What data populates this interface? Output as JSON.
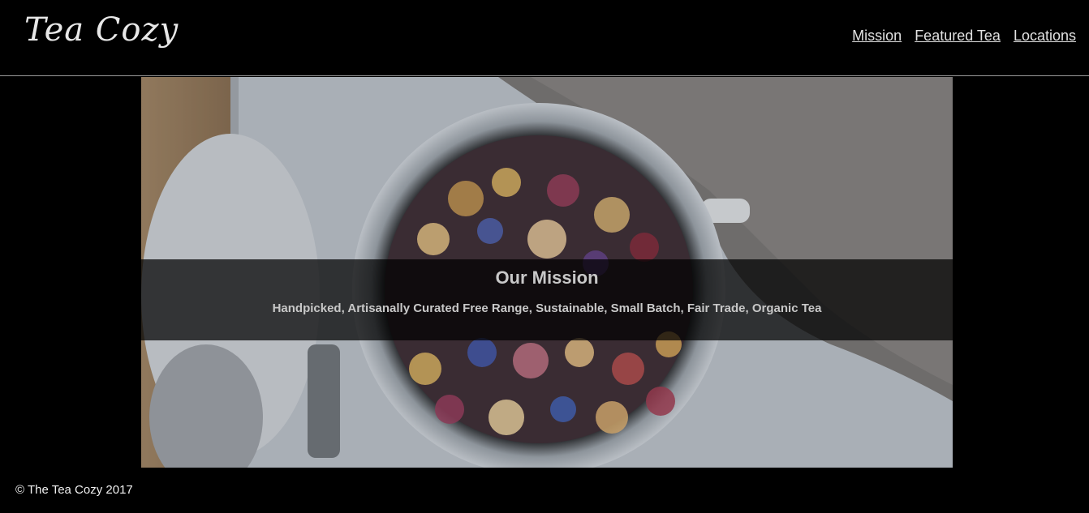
{
  "header": {
    "logo_text": "Tea Cozy",
    "nav": [
      {
        "label": "Mission"
      },
      {
        "label": "Featured Tea"
      },
      {
        "label": "Locations"
      }
    ]
  },
  "hero": {
    "image_name": "tea-jar-photo",
    "mission_title": "Our Mission",
    "mission_text": "Handpicked, Artisanally Curated Free Range, Sustainable, Small Batch, Fair Trade, Organic Tea"
  },
  "footer": {
    "copyright": "© The Tea Cozy 2017"
  },
  "colors": {
    "background": "#000000",
    "overlay": "rgba(0,0,0,0.72)",
    "text_light": "#c8c8c8"
  }
}
